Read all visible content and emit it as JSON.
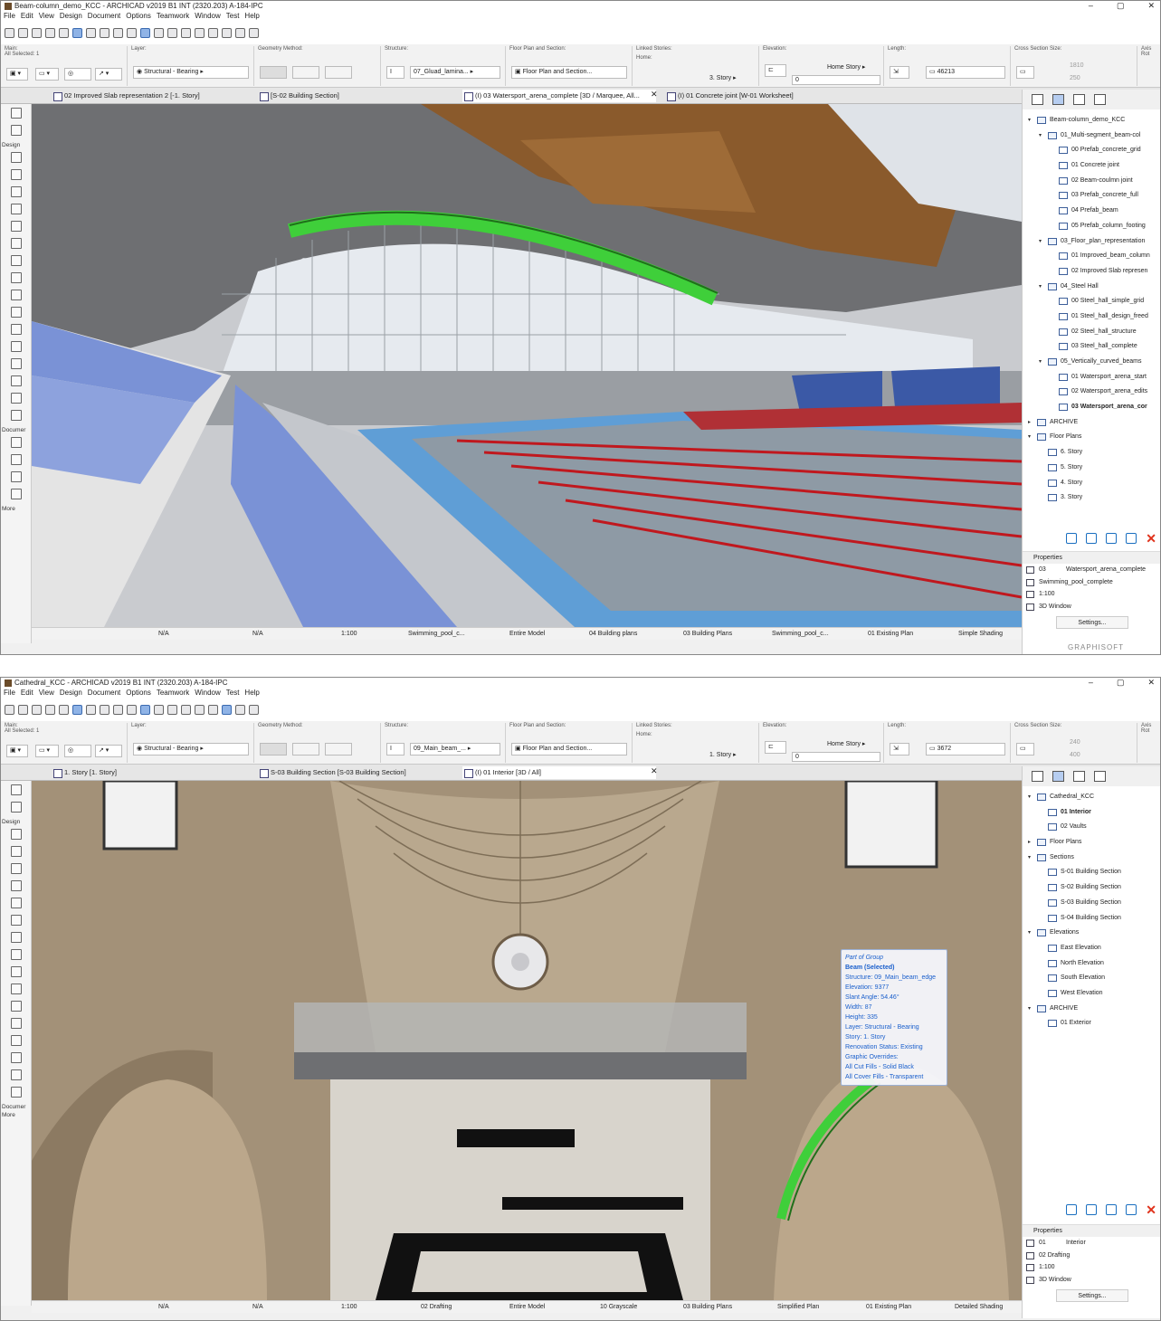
{
  "screen1": {
    "title": "Beam-column_demo_KCC - ARCHICAD v2019 B1 INT (2320.203) A-184-IPC",
    "menu": [
      "File",
      "Edit",
      "View",
      "Design",
      "Document",
      "Options",
      "Teamwork",
      "Window",
      "Test",
      "Help"
    ],
    "info": {
      "main_label": "Main:",
      "all_selected": "All Selected: 1",
      "layer_label": "Layer:",
      "layer_value": "Structural - Bearing",
      "geometry_label": "Geometry Method:",
      "structure_label": "Structure:",
      "structure_value": "07_Gluad_lamina...",
      "floorplan_label": "Floor Plan and Section:",
      "floorplan_value": "Floor Plan and Section...",
      "linked_label": "Linked Stories:",
      "linked_home": "Home:",
      "linked_story": "3. Story",
      "elevation_label": "Elevation:",
      "elevation_home": "Home Story",
      "elevation_value": "0",
      "length_label": "Length:",
      "length_value": "46213",
      "cross_label": "Cross Section Size:",
      "cross_w": "1810",
      "cross_h": "250",
      "axis_label": "Axis Rot"
    },
    "tabs": [
      "02 Improved Slab representation 2 [-1. Story]",
      "[S-02 Building Section]",
      "(I) 03 Watersport_arena_complete [3D / Marquee, All...",
      "(I) 01 Concrete joint [W-01 Worksheet]"
    ],
    "toolbox_labels": [
      "Design",
      "Documer",
      "More"
    ],
    "tree": [
      {
        "label": "Beam-column_demo_KCC",
        "lvl": 0,
        "exp": "v"
      },
      {
        "label": "01_Multi-segment_beam-col",
        "lvl": 1,
        "exp": "v"
      },
      {
        "label": "00 Prefab_concrete_grid",
        "lvl": 2,
        "exp": ""
      },
      {
        "label": "01 Concrete joint",
        "lvl": 2,
        "exp": ""
      },
      {
        "label": "02 Beam-coulmn joint",
        "lvl": 2,
        "exp": ""
      },
      {
        "label": "03 Prefab_concrete_full",
        "lvl": 2,
        "exp": ""
      },
      {
        "label": "04 Prefab_beam",
        "lvl": 2,
        "exp": ""
      },
      {
        "label": "05 Prefab_column_footing",
        "lvl": 2,
        "exp": ""
      },
      {
        "label": "03_Floor_plan_representation",
        "lvl": 1,
        "exp": "v"
      },
      {
        "label": "01 Improved_beam_column",
        "lvl": 2,
        "exp": ""
      },
      {
        "label": "02 Improved Slab represen",
        "lvl": 2,
        "exp": ""
      },
      {
        "label": "04_Steel Hall",
        "lvl": 1,
        "exp": "v"
      },
      {
        "label": "00 Steel_hall_simple_grid",
        "lvl": 2,
        "exp": ""
      },
      {
        "label": "01 Steel_hall_design_freed",
        "lvl": 2,
        "exp": ""
      },
      {
        "label": "02 Steel_hall_structure",
        "lvl": 2,
        "exp": ""
      },
      {
        "label": "03 Steel_hall_complete",
        "lvl": 2,
        "exp": ""
      },
      {
        "label": "05_Vertically_curved_beams",
        "lvl": 1,
        "exp": "v"
      },
      {
        "label": "01 Watersport_arena_start",
        "lvl": 2,
        "exp": ""
      },
      {
        "label": "02 Watersport_arena_edits",
        "lvl": 2,
        "exp": ""
      },
      {
        "label": "03 Watersport_arena_cor",
        "lvl": 2,
        "exp": "",
        "bold": true
      },
      {
        "label": "ARCHIVE",
        "lvl": 0,
        "exp": ">"
      },
      {
        "label": "Floor Plans",
        "lvl": 0,
        "exp": "v"
      },
      {
        "label": "6. Story",
        "lvl": 1,
        "exp": ""
      },
      {
        "label": "5. Story",
        "lvl": 1,
        "exp": ""
      },
      {
        "label": "4. Story",
        "lvl": 1,
        "exp": ""
      },
      {
        "label": "3. Story",
        "lvl": 1,
        "exp": ""
      }
    ],
    "props": {
      "header": "Properties",
      "id": "03",
      "name": "Watersport_arena_complete",
      "row2": "Swimming_pool_complete",
      "scale": "1:100",
      "window": "3D Window",
      "settings": "Settings..."
    },
    "status": [
      "N/A",
      "N/A",
      "1:100",
      "Swimming_pool_c...",
      "Entire Model",
      "04 Building plans",
      "03 Building Plans",
      "Swimming_pool_c...",
      "01 Existing Plan",
      "Simple Shading"
    ],
    "brand": "GRAPHISOFT"
  },
  "screen2": {
    "title": "Cathedral_KCC - ARCHICAD v2019 B1 INT (2320.203) A-184-IPC",
    "menu": [
      "File",
      "Edit",
      "View",
      "Design",
      "Document",
      "Options",
      "Teamwork",
      "Window",
      "Test",
      "Help"
    ],
    "info": {
      "main_label": "Main:",
      "all_selected": "All Selected: 1",
      "layer_label": "Layer:",
      "layer_value": "Structural - Bearing",
      "geometry_label": "Geometry Method:",
      "structure_label": "Structure:",
      "structure_value": "09_Main_beam_...",
      "floorplan_label": "Floor Plan and Section:",
      "floorplan_value": "Floor Plan and Section...",
      "linked_label": "Linked Stories:",
      "linked_home": "Home:",
      "linked_story": "1. Story",
      "elevation_label": "Elevation:",
      "elevation_home": "Home Story",
      "elevation_value": "0",
      "length_label": "Length:",
      "length_value": "3672",
      "cross_label": "Cross Section Size:",
      "cross_w": "240",
      "cross_h": "400",
      "axis_label": "Axis Rot"
    },
    "tabs": [
      "1. Story [1. Story]",
      "S-03 Building Section [S-03 Building Section]",
      "(I) 01 Interior [3D / All]"
    ],
    "toolbox_labels": [
      "Design",
      "Documer",
      "More"
    ],
    "tree": [
      {
        "label": "Cathedral_KCC",
        "lvl": 0,
        "exp": "v"
      },
      {
        "label": "01 Interior",
        "lvl": 1,
        "exp": "",
        "bold": true
      },
      {
        "label": "02 Vaults",
        "lvl": 1,
        "exp": ""
      },
      {
        "label": "Floor Plans",
        "lvl": 0,
        "exp": ">"
      },
      {
        "label": "Sections",
        "lvl": 0,
        "exp": "v"
      },
      {
        "label": "S-01 Building Section",
        "lvl": 1,
        "exp": ""
      },
      {
        "label": "S-02 Building Section",
        "lvl": 1,
        "exp": ""
      },
      {
        "label": "S-03 Building Section",
        "lvl": 1,
        "exp": ""
      },
      {
        "label": "S-04 Building Section",
        "lvl": 1,
        "exp": ""
      },
      {
        "label": "Elevations",
        "lvl": 0,
        "exp": "v"
      },
      {
        "label": "East Elevation",
        "lvl": 1,
        "exp": ""
      },
      {
        "label": "North Elevation",
        "lvl": 1,
        "exp": ""
      },
      {
        "label": "South Elevation",
        "lvl": 1,
        "exp": ""
      },
      {
        "label": "West Elevation",
        "lvl": 1,
        "exp": ""
      },
      {
        "label": "ARCHIVE",
        "lvl": 0,
        "exp": "v"
      },
      {
        "label": "01 Exterior",
        "lvl": 1,
        "exp": ""
      }
    ],
    "props": {
      "header": "Properties",
      "id": "01",
      "name": "Interior",
      "row2": "02 Drafting",
      "scale": "1:100",
      "window": "3D Window",
      "settings": "Settings..."
    },
    "tooltip": {
      "line0": "Part of Group",
      "line1": "Beam (Selected)",
      "line2": "Structure: 09_Main_beam_edge",
      "line3": "Elevation: 9377",
      "line4": "Slant Angle: 54.46°",
      "line5": "Width: 87",
      "line6": "Height: 335",
      "line7": "Layer: Structural - Bearing",
      "line8": "Story: 1. Story",
      "line9": "Renovation Status: Existing",
      "line10": "Graphic Overrides:",
      "line11": "All Cut Fills - Solid Black",
      "line12": "All Cover Fills - Transparent"
    },
    "status": [
      "N/A",
      "N/A",
      "1:100",
      "02 Drafting",
      "Entire Model",
      "10 Grayscale",
      "03 Building Plans",
      "Simplified Plan",
      "01 Existing Plan",
      "Detailed Shading"
    ]
  },
  "colors": {
    "selection_green": "#3fcf3a",
    "seat_blue": "#7a92d6",
    "pool_water": "#5f9ed6",
    "lane_red": "#c0181e",
    "wood_beam": "#8a5a2c",
    "stone": "#a39178",
    "link_blue": "#1a5fcc",
    "delete_red": "#e0321b"
  },
  "icons": [
    "pointer-icon",
    "marquee-icon",
    "wall-icon",
    "column-icon",
    "beam-icon",
    "slab-icon",
    "roof-icon",
    "stair-icon",
    "morph-icon",
    "curtain-wall-icon",
    "folder-icon",
    "view-icon",
    "delete-icon",
    "settings-icon"
  ]
}
